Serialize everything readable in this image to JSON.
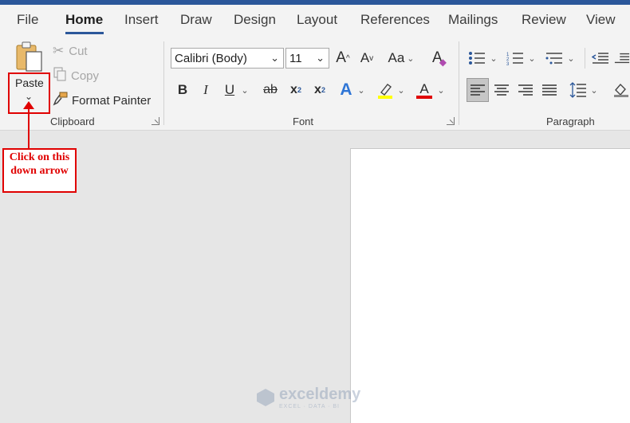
{
  "tabs": [
    "File",
    "Home",
    "Insert",
    "Draw",
    "Design",
    "Layout",
    "References",
    "Mailings",
    "Review",
    "View"
  ],
  "active_tab": "Home",
  "clipboard": {
    "group_label": "Clipboard",
    "paste_label": "Paste",
    "cut_label": "Cut",
    "copy_label": "Copy",
    "format_painter_label": "Format Painter"
  },
  "font": {
    "group_label": "Font",
    "font_name": "Calibri (Body)",
    "font_size": "11",
    "change_case_label": "Aa"
  },
  "paragraph": {
    "group_label": "Paragraph"
  },
  "annotation": {
    "text": "Click on this down arrow",
    "color": "#e00000"
  },
  "watermark": {
    "title": "exceldemy",
    "subtitle": "EXCEL · DATA · BI"
  },
  "colors": {
    "accent": "#2b579a",
    "highlight": "#ffff00",
    "font_color": "#e00000"
  }
}
